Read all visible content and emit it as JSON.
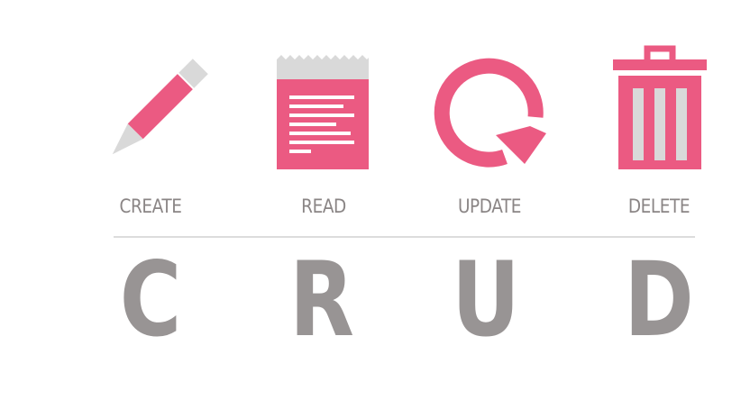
{
  "colors": {
    "accent": "#eb5a82",
    "icon_gray": "#d9d9d9",
    "label_gray": "#8a8585",
    "letter_gray": "#989494",
    "divider": "#dcdcdc"
  },
  "operations": [
    {
      "label": "CREATE",
      "letter": "C",
      "icon": "pencil-icon"
    },
    {
      "label": "READ",
      "letter": "R",
      "icon": "document-icon"
    },
    {
      "label": "UPDATE",
      "letter": "U",
      "icon": "refresh-icon"
    },
    {
      "label": "DELETE",
      "letter": "D",
      "icon": "trash-icon"
    }
  ]
}
